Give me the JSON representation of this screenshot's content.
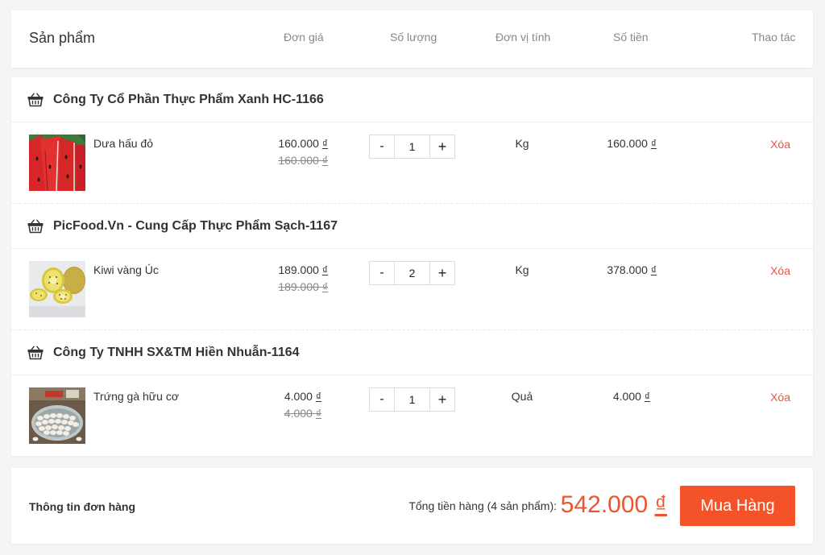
{
  "header": {
    "product_label": "Sản phẩm",
    "unit_price_label": "Đơn giá",
    "quantity_label": "Số lượng",
    "unit_label": "Đơn vị tính",
    "amount_label": "Số tiền",
    "actions_label": "Thao tác"
  },
  "currency_symbol": "₫",
  "shops": [
    {
      "name": "Công Ty Cổ Phần Thực Phẩm Xanh HC-1166",
      "icon": "basket-icon",
      "item": {
        "name": "Dưa hấu đỏ",
        "image": "watermaelon-image",
        "price": "160.000",
        "original_price": "160.000",
        "quantity": "1",
        "unit": "Kg",
        "line_total": "160.000",
        "delete_label": "Xóa"
      }
    },
    {
      "name": "PicFood.Vn - Cung Cấp Thực Phẩm Sạch-1167",
      "icon": "basket-icon",
      "item": {
        "name": "Kiwi vàng Úc",
        "image": "kiwi-image",
        "price": "189.000",
        "original_price": "189.000",
        "quantity": "2",
        "unit": "Kg",
        "line_total": "378.000",
        "delete_label": "Xóa"
      }
    },
    {
      "name": "Công Ty TNHH SX&TM Hiền Nhuẫn-1164",
      "icon": "basket-icon",
      "item": {
        "name": "Trứng gà hữu cơ",
        "image": "eggs-image",
        "price": "4.000",
        "original_price": "4.000",
        "quantity": "1",
        "unit": "Quả",
        "line_total": "4.000",
        "delete_label": "Xóa"
      }
    }
  ],
  "qty_minus": "-",
  "qty_plus": "+",
  "footer": {
    "title": "Thông tin đơn hàng",
    "total_label": "Tổng tiền hàng (4 sản phẩm):",
    "total_value": "542.000",
    "buy_label": "Mua Hàng"
  },
  "colors": {
    "accent": "#f4532a",
    "delete": "#e8533c"
  }
}
